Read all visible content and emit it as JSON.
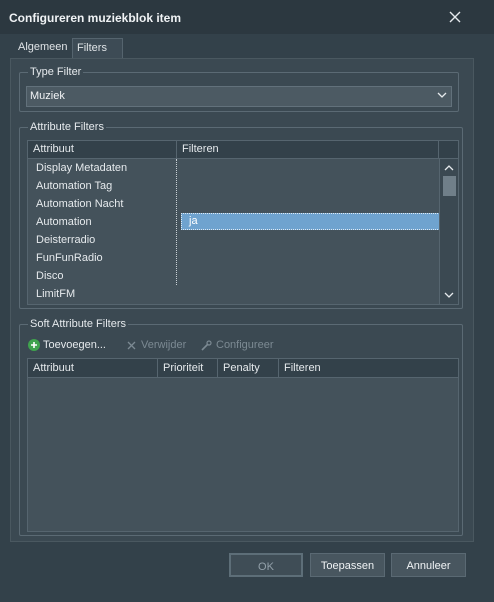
{
  "dialog": {
    "title": "Configureren muziekblok item"
  },
  "tabs": [
    {
      "label": "Algemeen",
      "active": false
    },
    {
      "label": "Filters",
      "active": true
    }
  ],
  "type_filter": {
    "group_title": "Type Filter",
    "selected": "Muziek"
  },
  "attribute_filters": {
    "group_title": "Attribute Filters",
    "columns": [
      "Attribuut",
      "Filteren"
    ],
    "rows": [
      {
        "attribute": "Display Metadaten",
        "filter": ""
      },
      {
        "attribute": "Automation Tag",
        "filter": ""
      },
      {
        "attribute": "Automation Nacht",
        "filter": ""
      },
      {
        "attribute": "Automation",
        "filter": "ja"
      },
      {
        "attribute": "Deisterradio",
        "filter": ""
      },
      {
        "attribute": "FunFunRadio",
        "filter": ""
      },
      {
        "attribute": "Disco",
        "filter": ""
      },
      {
        "attribute": "LimitFM",
        "filter": ""
      }
    ],
    "selected_row": 3
  },
  "soft_attribute_filters": {
    "group_title": "Soft Attribute Filters",
    "toolbar": {
      "add": "Toevoegen...",
      "remove": "Verwijder",
      "configure": "Configureer"
    },
    "columns": [
      "Attribuut",
      "Prioriteit",
      "Penalty",
      "Filteren"
    ]
  },
  "buttons": {
    "ok": "OK",
    "apply": "Toepassen",
    "cancel": "Annuleer"
  },
  "colors": {
    "background": "#33414a",
    "selection": "#6fa3cf",
    "add_icon": "#3fa34d"
  }
}
